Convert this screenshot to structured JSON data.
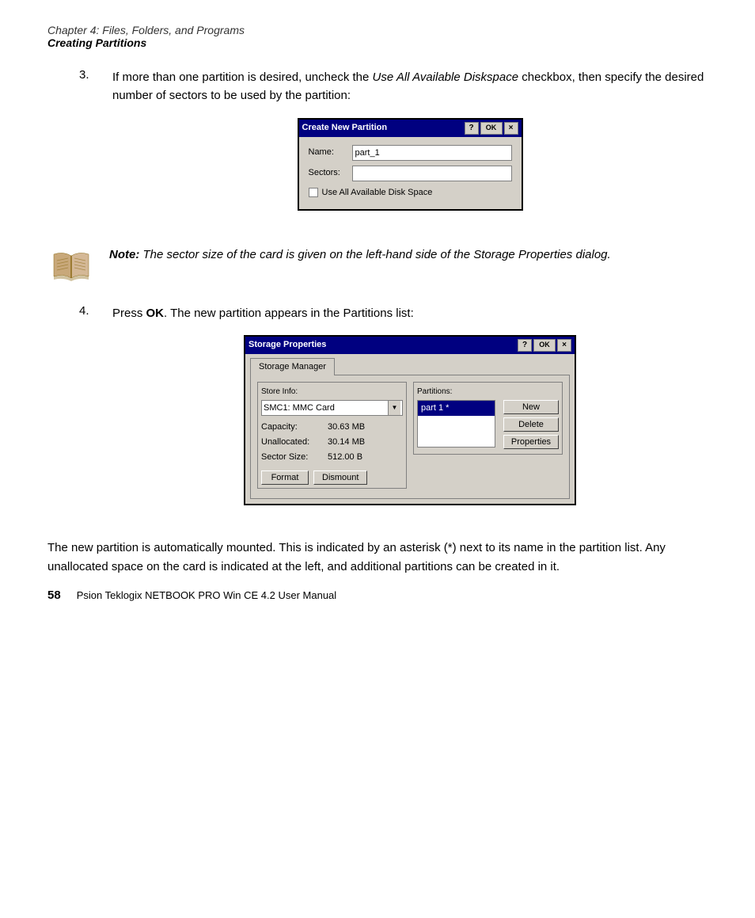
{
  "header": {
    "chapter": "Chapter 4:  Files, Folders, and Programs",
    "section": "Creating Partitions"
  },
  "steps": [
    {
      "number": "3.",
      "text_parts": [
        "If more than one partition is desired, uncheck the ",
        "Use All Available Diskspace",
        " checkbox, then specify the desired number of sectors to be used by the partition:"
      ]
    },
    {
      "number": "4.",
      "text_before": "Press ",
      "bold": "OK",
      "text_after": ". The new partition appears in the Partitions list:"
    }
  ],
  "create_partition_dialog": {
    "title": "Create New Partition",
    "help_btn": "?",
    "ok_btn": "OK",
    "close_btn": "×",
    "name_label": "Name:",
    "name_value": "part_1",
    "sectors_label": "Sectors:",
    "sectors_value": "",
    "checkbox_label": "Use All Available Disk Space",
    "checkbox_checked": false
  },
  "note": {
    "label": "Note:",
    "text": "The sector size of the card is given on the left-hand side of the Storage Properties dialog."
  },
  "storage_dialog": {
    "title": "Storage Properties",
    "help_btn": "?",
    "ok_btn": "OK",
    "close_btn": "×",
    "tab_label": "Storage Manager",
    "store_info": {
      "group_label": "Store Info:",
      "dropdown_value": "SMC1: MMC Card",
      "capacity_label": "Capacity:",
      "capacity_value": "30.63 MB",
      "unallocated_label": "Unallocated:",
      "unallocated_value": "30.14 MB",
      "sector_label": "Sector Size:",
      "sector_value": "512.00 B",
      "format_btn": "Format",
      "dismount_btn": "Dismount"
    },
    "partitions": {
      "group_label": "Partitions:",
      "items": [
        "part 1 *",
        ""
      ],
      "new_btn": "New",
      "delete_btn": "Delete",
      "properties_btn": "Properties"
    }
  },
  "body_text": "The new partition is automatically mounted. This is indicated by an asterisk (*) next to its name in the partition list. Any unallocated space on the card is indicated at the left, and additional partitions can be created in it.",
  "footer": {
    "page_number": "58",
    "title": "Psion Teklogix NETBOOK PRO Win CE 4.2 User Manual"
  }
}
